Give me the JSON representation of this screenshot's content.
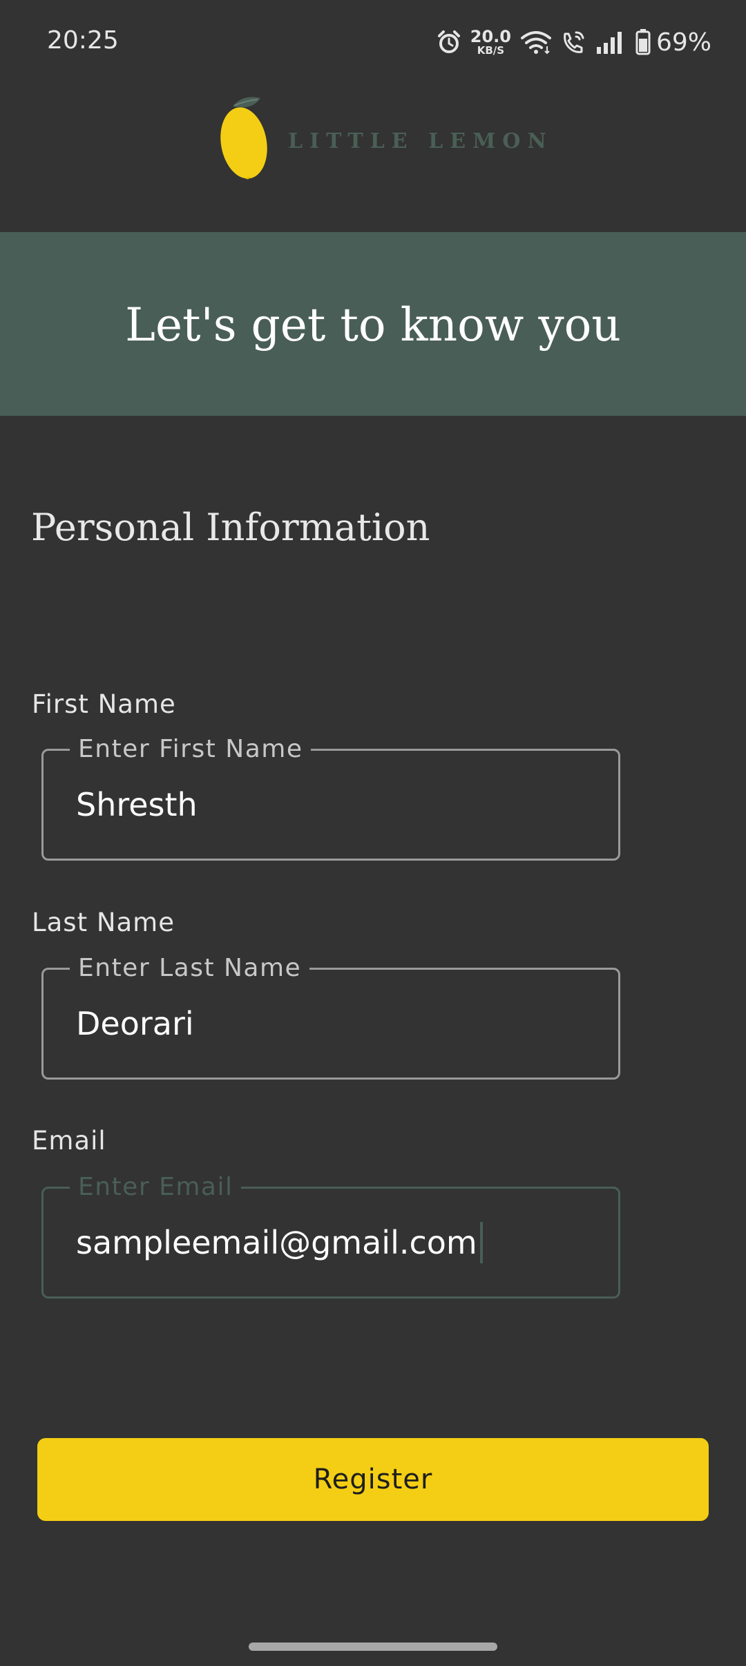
{
  "status_bar": {
    "time": "20:25",
    "net_speed_value": "20.0",
    "net_speed_unit": "KB/S",
    "battery": "69%",
    "icons": [
      "alarm-icon",
      "wifi-icon",
      "wifi-call-icon",
      "signal-icon",
      "battery-icon"
    ]
  },
  "header": {
    "logo_text": "LITTLE LEMON"
  },
  "hero": {
    "title": "Let's get to know you"
  },
  "form": {
    "section_title": "Personal Information",
    "first_name": {
      "label": "First Name",
      "placeholder": "Enter First Name",
      "value": "Shresth"
    },
    "last_name": {
      "label": "Last Name",
      "placeholder": "Enter Last Name",
      "value": "Deorari"
    },
    "email": {
      "label": "Email",
      "placeholder": "Enter Email",
      "value": "sampleemail@gmail.com"
    },
    "register_label": "Register"
  },
  "colors": {
    "background": "#333333",
    "primary_green": "#495E57",
    "primary_yellow": "#F4CE14",
    "field_border": "#9A9A9A"
  }
}
